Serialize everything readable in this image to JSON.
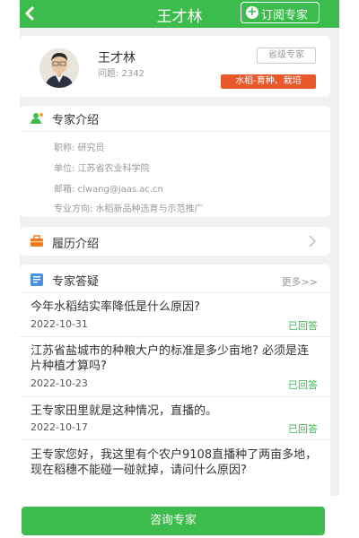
{
  "header": {
    "title": "王才林",
    "subscribe_label": "订阅专家"
  },
  "profile": {
    "name": "王才林",
    "question_count": "问题: 2342",
    "level_badge": "省级专家",
    "specialty_tag": "水稻-育种、栽培"
  },
  "intro": {
    "title": "专家介绍",
    "title_line": "职称: 研究员",
    "unit_line": "单位: 江苏省农业科学院",
    "email_line": "邮箱: clwang@jaas.ac.cn",
    "field_line": "专业方向: 水稻新品种选育与示范推广"
  },
  "resume": {
    "title": "履历介绍"
  },
  "qa": {
    "title": "专家答疑",
    "more_label": "更多>>",
    "items": [
      {
        "question": "今年水稻结实率降低是什么原因?",
        "date": "2022-10-31",
        "status": "已回答"
      },
      {
        "question": "江苏省盐城市的种粮大户的标准是多少亩地? 必须是连片种植才算吗?",
        "date": "2022-10-23",
        "status": "已回答"
      },
      {
        "question": "王专家田里就是这种情况，直播的。",
        "date": "2022-10-17",
        "status": "已回答"
      },
      {
        "question": "王专家您好，我这里有个农户9108直播种了两亩多地，现在稻穗不能碰一碰就掉，请问什么原因?",
        "date": "",
        "status": ""
      }
    ]
  },
  "footer": {
    "consult_label": "咨询专家"
  },
  "colors": {
    "primary_green": "#3cbc4c",
    "tag_orange": "#e8582b"
  }
}
